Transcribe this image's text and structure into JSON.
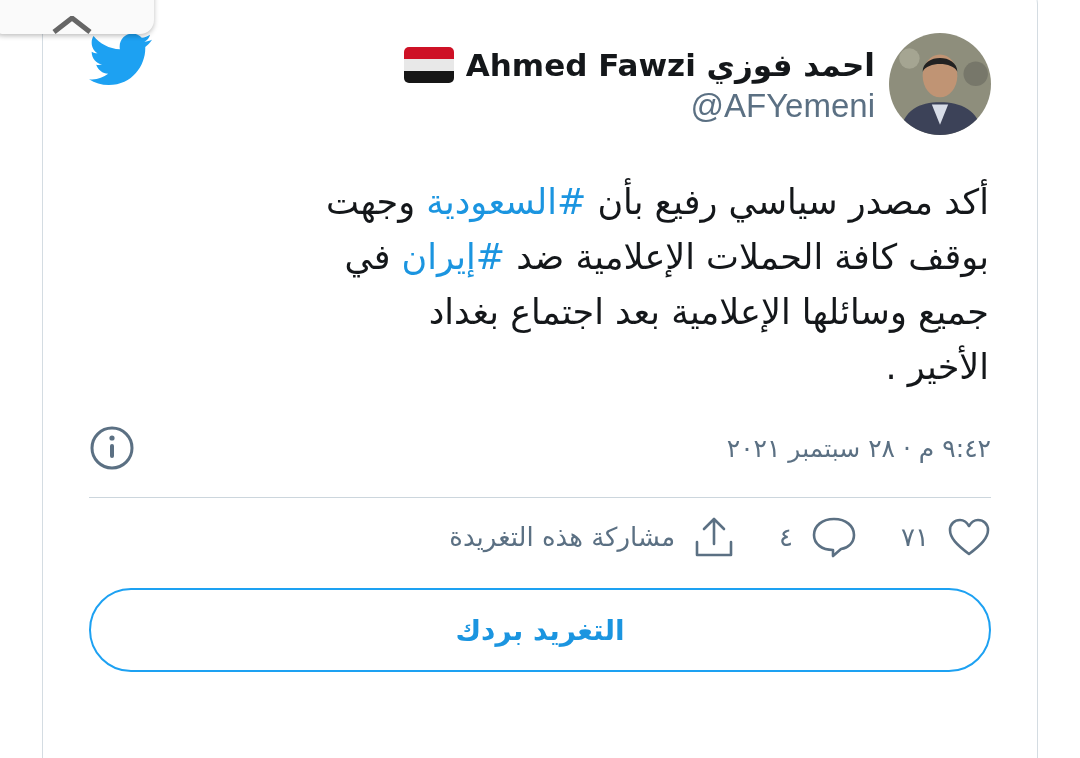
{
  "author": {
    "name": "احمد فوزي Ahmed Fawzi",
    "handle": "@AFYemeni"
  },
  "tweet": {
    "lines": [
      [
        {
          "kind": "text",
          "text": "أكد مصدر سياسي رفيع بأن "
        },
        {
          "kind": "hashtag",
          "text": "#السعودية"
        },
        {
          "kind": "text",
          "text": " وجهت"
        }
      ],
      [
        {
          "kind": "text",
          "text": "بوقف كافة الحملات الإعلامية ضد "
        },
        {
          "kind": "hashtag",
          "text": "#إيران"
        },
        {
          "kind": "text",
          "text": " في"
        }
      ],
      [
        {
          "kind": "text",
          "text": "جميع وسائلها الإعلامية بعد اجتماع بغداد"
        }
      ],
      [
        {
          "kind": "text",
          "text": "الأخير ."
        }
      ]
    ]
  },
  "timestamp": "٩:٤٢ م · ٢٨ سبتمبر ٢٠٢١",
  "actions": [
    {
      "kind": "like",
      "label": "٧١"
    },
    {
      "kind": "reply",
      "label": "٤"
    },
    {
      "kind": "share",
      "label": "مشاركة هذه التغريدة"
    }
  ],
  "reply_button": "التغريد بردك"
}
